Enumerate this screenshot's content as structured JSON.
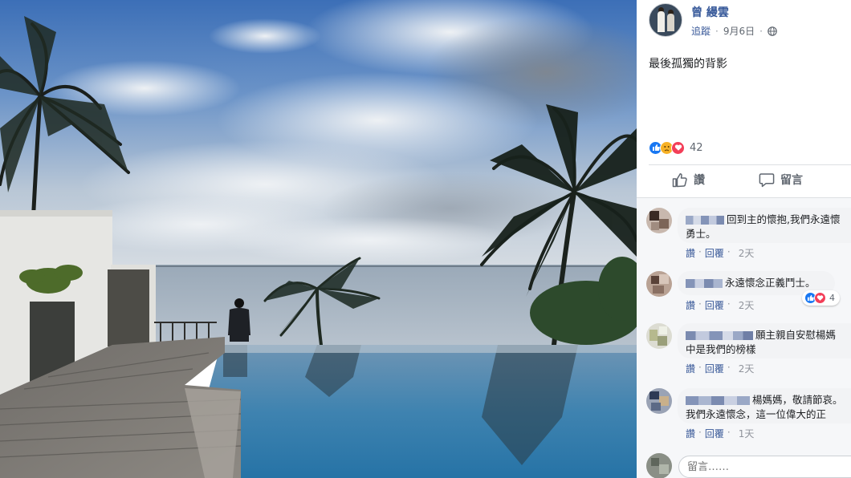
{
  "post": {
    "author": "曾 縵雲",
    "follow_label": "追蹤",
    "date": "9月6日",
    "dot": "·",
    "privacy_icon": "globe-icon",
    "text": "最後孤獨的背影"
  },
  "reactions": {
    "icons": [
      "like-icon",
      "sad-icon",
      "love-icon"
    ],
    "count": "42"
  },
  "actions": {
    "like_label": "讚",
    "comment_label": "留言"
  },
  "comments": [
    {
      "text_line1": "回到主的懷抱,我們永遠懷",
      "text_line2": "勇士。",
      "like": "讚",
      "reply": "回覆",
      "time": "2天"
    },
    {
      "text_line1": "永遠懷念正義鬥士。",
      "text_line2": "",
      "like": "讚",
      "reply": "回覆",
      "time": "2天",
      "reaction_count": "4"
    },
    {
      "text_line1": "願主親自安慰楊媽",
      "text_line2": "中是我們的榜樣",
      "like": "讚",
      "reply": "回覆",
      "time": "2天"
    },
    {
      "text_line1": "楊媽媽，敬請節哀。",
      "text_line2": "我們永遠懷念，這一位偉大的正",
      "like": "讚",
      "reply": "回覆",
      "time": "1天"
    }
  ],
  "composer": {
    "placeholder": "留言……"
  },
  "colors": {
    "link": "#365899",
    "like_blue": "#1877f2",
    "love_red": "#f33e58",
    "sad_yellow": "#f7b125",
    "panel_bg": "#f6f7f9"
  }
}
